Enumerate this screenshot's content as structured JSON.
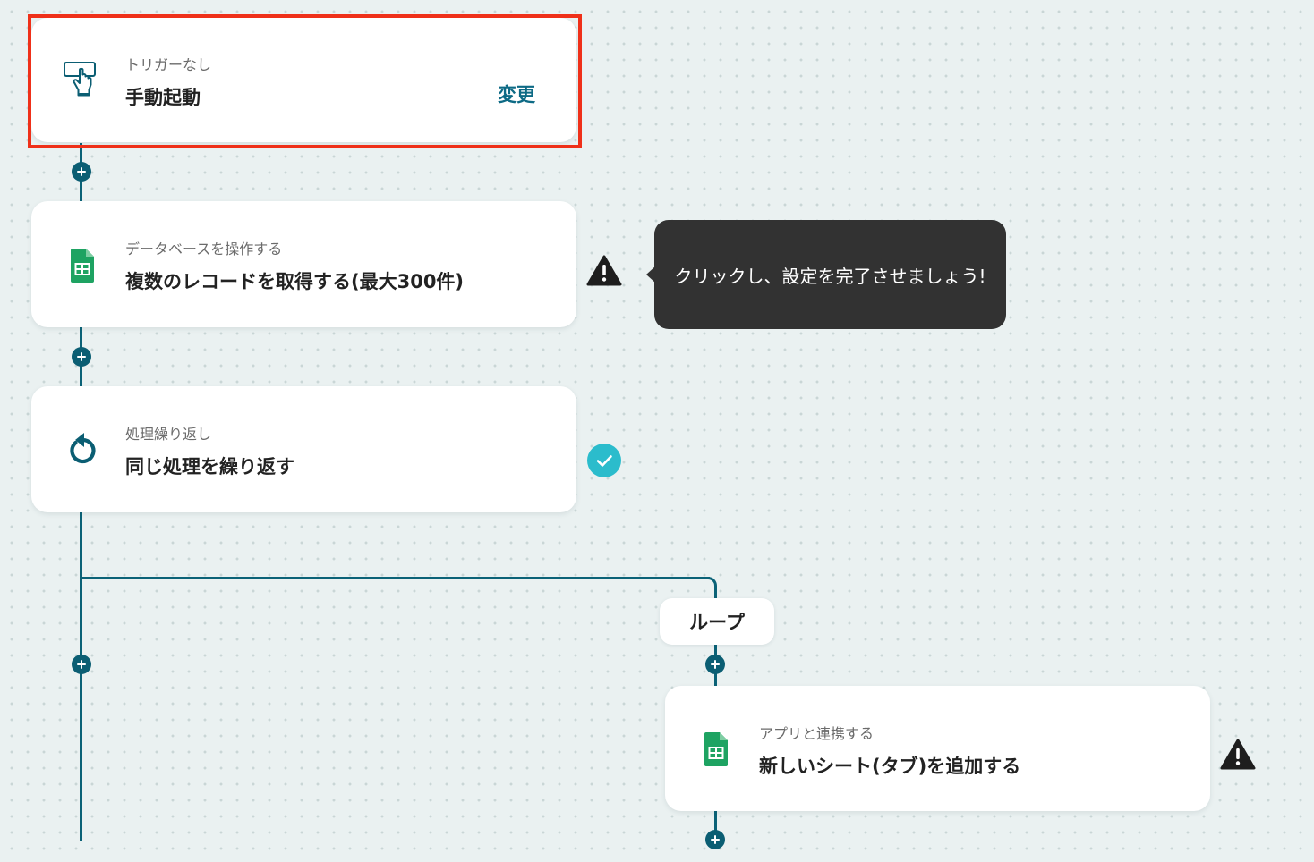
{
  "colors": {
    "accent": "#0b5e73",
    "highlight": "#ef3019",
    "warning": "#1e1e1e",
    "success": "#2bbccc",
    "tooltip_bg": "#323232",
    "sheets_green": "#1ea362"
  },
  "steps": [
    {
      "icon": "hand-pointer-icon",
      "subtitle": "トリガーなし",
      "title": "手動起動",
      "action_label": "変更",
      "highlighted": true
    },
    {
      "icon": "google-sheets-icon",
      "subtitle": "データベースを操作する",
      "title": "複数のレコードを取得する(最大300件)",
      "status": "warning"
    },
    {
      "icon": "loop-icon",
      "subtitle": "処理繰り返し",
      "title": "同じ処理を繰り返す",
      "status": "complete"
    },
    {
      "icon": "google-sheets-icon",
      "subtitle": "アプリと連携する",
      "title": "新しいシート(タブ)を追加する",
      "status": "warning"
    }
  ],
  "tooltip": {
    "text": "クリックし、設定を完了させましょう!"
  },
  "loop": {
    "label": "ループ"
  }
}
